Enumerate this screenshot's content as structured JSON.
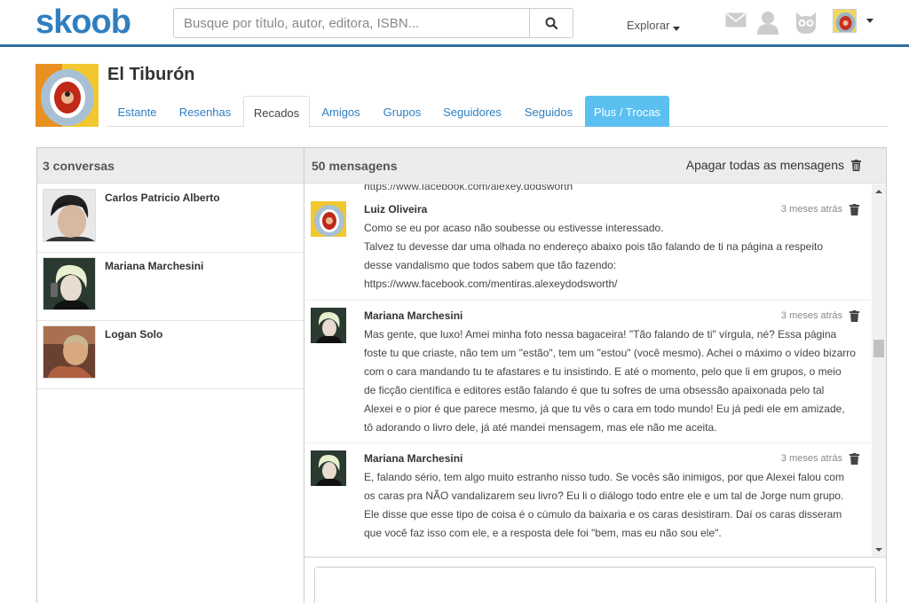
{
  "header": {
    "logo": "skoob",
    "search_placeholder": "Busque por título, autor, editora, ISBN...",
    "explore_label": "Explorar"
  },
  "profile": {
    "name": "El Tiburón"
  },
  "tabs": [
    {
      "label": "Estante"
    },
    {
      "label": "Resenhas"
    },
    {
      "label": "Recados"
    },
    {
      "label": "Amigos"
    },
    {
      "label": "Grupos"
    },
    {
      "label": "Seguidores"
    },
    {
      "label": "Seguidos"
    },
    {
      "label": "Plus / Trocas"
    }
  ],
  "conversations": {
    "title": "3 conversas",
    "items": [
      {
        "name": "Carlos Patricio Alberto"
      },
      {
        "name": "Mariana Marchesini"
      },
      {
        "name": "Logan Solo"
      }
    ]
  },
  "messages": {
    "title": "50 mensagens",
    "delete_all_label": "Apagar todas as mensagens",
    "partial_top": "https://www.facebook.com/alexey.dodsworth",
    "items": [
      {
        "author": "Luiz Oliveira",
        "time": "3 meses atrás",
        "lines": [
          "Como se eu por acaso não soubesse ou estivesse interessado.",
          "Talvez tu devesse dar uma olhada no endereço abaixo pois tão falando de ti na página a respeito",
          "desse vandalismo que todos sabem que tão fazendo:",
          "https://www.facebook.com/mentiras.alexeydodsworth/"
        ]
      },
      {
        "author": "Mariana Marchesini",
        "time": "3 meses atrás",
        "lines": [
          "Mas gente, que luxo! Amei minha foto nessa bagaceira! \"Tão falando de ti\" vírgula, né? Essa página",
          "foste tu que criaste, não tem um \"estão\", tem um \"estou\" (você mesmo). Achei o máximo o vídeo bizarro",
          "com o cara mandando tu te afastares e tu insistindo. E até o momento, pelo que li em grupos, o meio",
          "de ficção científica e editores estão falando é que tu sofres de uma obsessão apaixonada pelo tal",
          "Alexei e o pior é que parece mesmo, já que tu vês o cara em todo mundo! Eu já pedi ele em amizade,",
          "tô adorando o livro dele, já até mandei mensagem, mas ele não me aceita."
        ]
      },
      {
        "author": "Mariana Marchesini",
        "time": "3 meses atrás",
        "lines": [
          "E, falando sério, tem algo muito estranho nisso tudo. Se vocês são inimigos, por que Alexei falou com",
          "os caras pra NÃO vandalizarem seu livro? Eu li o diálogo todo entre ele e um tal de Jorge num grupo.",
          "Ele disse que esse tipo de coisa é o cúmulo da baixaria e os caras desistiram. Daí os caras disseram",
          "que você faz isso com ele, e a resposta dele foi \"bem, mas eu não sou ele\"."
        ]
      }
    ]
  },
  "colors": {
    "brand": "#2f7fc1",
    "plus_tab": "#5bc0f0",
    "header_border": "#2d6f9e"
  }
}
